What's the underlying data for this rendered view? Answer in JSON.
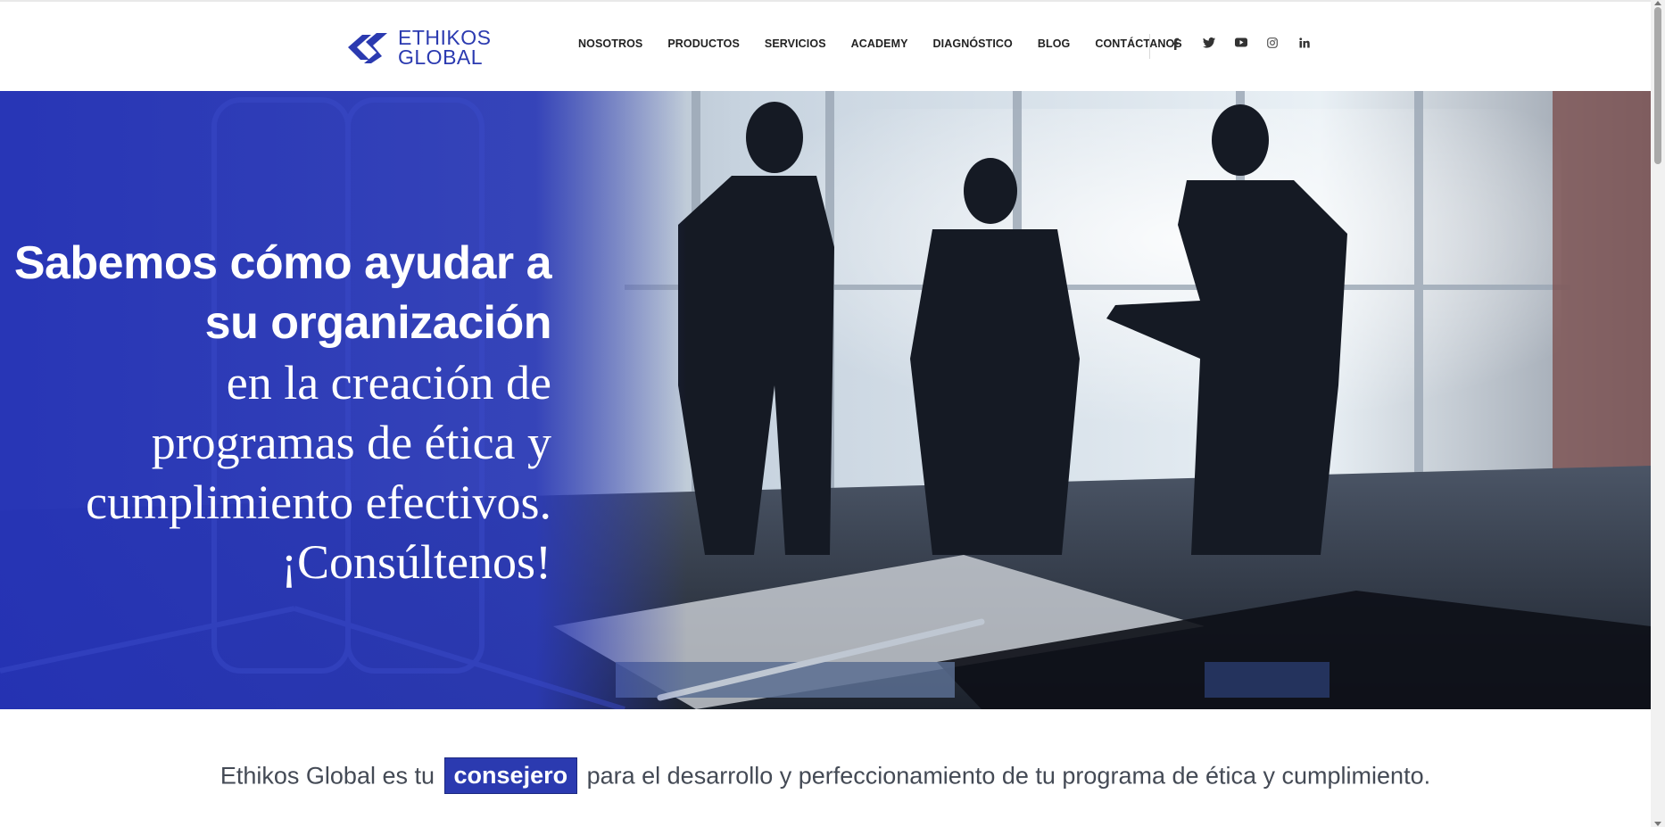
{
  "brand": {
    "line1": "ETHIKOS",
    "line2": "GLOBAL",
    "color": "#2b3ab0"
  },
  "nav": {
    "items": [
      "NOSOTROS",
      "PRODUCTOS",
      "SERVICIOS",
      "ACADEMY",
      "DIAGNÓSTICO",
      "BLOG",
      "CONTÁCTANOS"
    ]
  },
  "social": [
    "facebook-icon",
    "twitter-icon",
    "youtube-icon",
    "instagram-icon",
    "linkedin-icon"
  ],
  "hero": {
    "line1": "Sabemos cómo ayudar a",
    "line2": "su organización",
    "line3": "en la creación de",
    "line4": "programas de ética y",
    "line5": "cumplimiento efectivos.",
    "line6": "¡Consúltenos!"
  },
  "tagline": {
    "before": "Ethikos Global es tu",
    "highlight": "consejero",
    "after": "para el desarrollo y perfeccionamiento de tu programa de ética y cumplimiento."
  },
  "colors": {
    "accent": "#2b3ab0",
    "text": "#444a55"
  }
}
